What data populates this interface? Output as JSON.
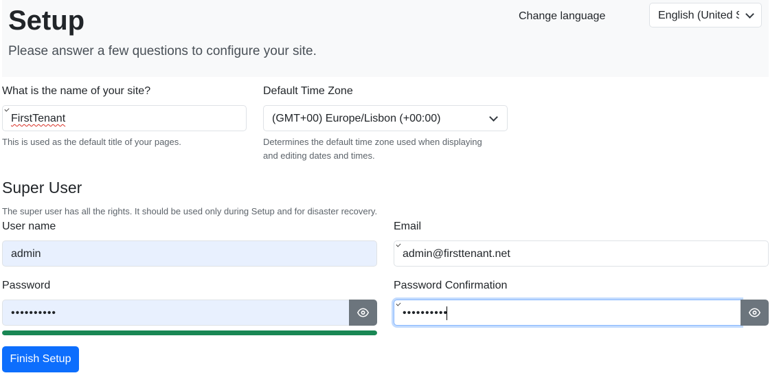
{
  "header": {
    "title": "Setup",
    "subtitle": "Please answer a few questions to configure your site.",
    "change_language_label": "Change language",
    "language_value": "English (United States)"
  },
  "site": {
    "name_label": "What is the name of your site?",
    "name_value": "FirstTenant",
    "name_help": "This is used as the default title of your pages.",
    "timezone_label": "Default Time Zone",
    "timezone_value": "(GMT+00) Europe/Lisbon (+00:00)",
    "timezone_help_line1": "Determines the default time zone used when displaying",
    "timezone_help_line2": "and editing dates and times."
  },
  "super_user": {
    "section_title": "Super User",
    "description": "The super user has all the rights. It should be used only during Setup and for disaster recovery.",
    "username_label": "User name",
    "username_value": "admin",
    "email_label": "Email",
    "email_value": "admin@firsttenant.net",
    "password_label": "Password",
    "password_value": "••••••••••",
    "password_confirm_label": "Password Confirmation",
    "password_confirm_value": "••••••••••",
    "password_strength": 1.0
  },
  "actions": {
    "finish_label": "Finish Setup"
  },
  "colors": {
    "primary": "#0d6efd",
    "strength_bar": "#198754",
    "eye_button": "#6c757d",
    "autofill_bg": "#e8f0fe",
    "header_bg": "#f8f9fa"
  },
  "icons": {
    "password_toggle": "eye-icon",
    "select_arrow": "chevron-down-icon"
  }
}
